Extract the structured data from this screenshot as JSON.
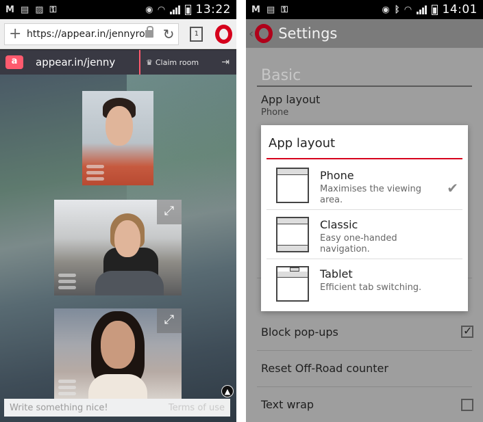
{
  "left": {
    "status": {
      "time": "13:22"
    },
    "browser": {
      "url": "https://appear.in/jennyro",
      "tabs_count": "1"
    },
    "appear": {
      "logo": "a",
      "room": "appear.in/jenny",
      "claim": "Claim room"
    },
    "chat": {
      "placeholder": "Write something nice!",
      "terms": "Terms of use"
    }
  },
  "right": {
    "status": {
      "time": "14:01"
    },
    "title": "Settings",
    "section": "Basic",
    "app_layout": {
      "title": "App layout",
      "value": "Phone"
    },
    "block_popups": {
      "title": "Block pop-ups",
      "checked": true
    },
    "reset_offroad": {
      "title": "Reset Off-Road counter"
    },
    "text_wrap": {
      "title": "Text wrap",
      "checked": false
    },
    "dialog": {
      "title": "App layout",
      "options": [
        {
          "title": "Phone",
          "desc": "Maximises the viewing area.",
          "selected": true
        },
        {
          "title": "Classic",
          "desc": "Easy one-handed navigation.",
          "selected": false
        },
        {
          "title": "Tablet",
          "desc": "Efficient tab switching.",
          "selected": false
        }
      ]
    }
  },
  "colors": {
    "opera_red": "#d6001c",
    "appear_pink": "#ff5a6e"
  }
}
